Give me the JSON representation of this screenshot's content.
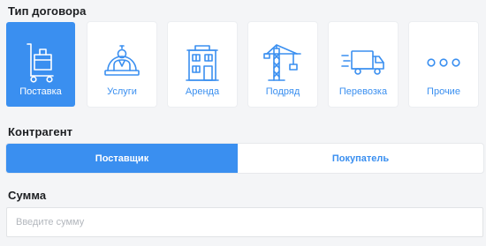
{
  "contract_type": {
    "label": "Тип договора",
    "options": [
      {
        "label": "Поставка",
        "icon": "cart-box-icon",
        "selected": true
      },
      {
        "label": "Услуги",
        "icon": "service-person-icon",
        "selected": false
      },
      {
        "label": "Аренда",
        "icon": "building-icon",
        "selected": false
      },
      {
        "label": "Подряд",
        "icon": "crane-icon",
        "selected": false
      },
      {
        "label": "Перевозка",
        "icon": "truck-icon",
        "selected": false
      },
      {
        "label": "Прочие",
        "icon": "more-dots-icon",
        "selected": false
      }
    ]
  },
  "counterparty": {
    "label": "Контрагент",
    "options": [
      {
        "label": "Поставщик",
        "selected": true
      },
      {
        "label": "Покупатель",
        "selected": false
      }
    ]
  },
  "amount": {
    "label": "Сумма",
    "placeholder": "Введите сумму",
    "value": ""
  },
  "colors": {
    "accent": "#3a8ff0",
    "background": "#f4f5f7",
    "tile": "#ffffff"
  }
}
